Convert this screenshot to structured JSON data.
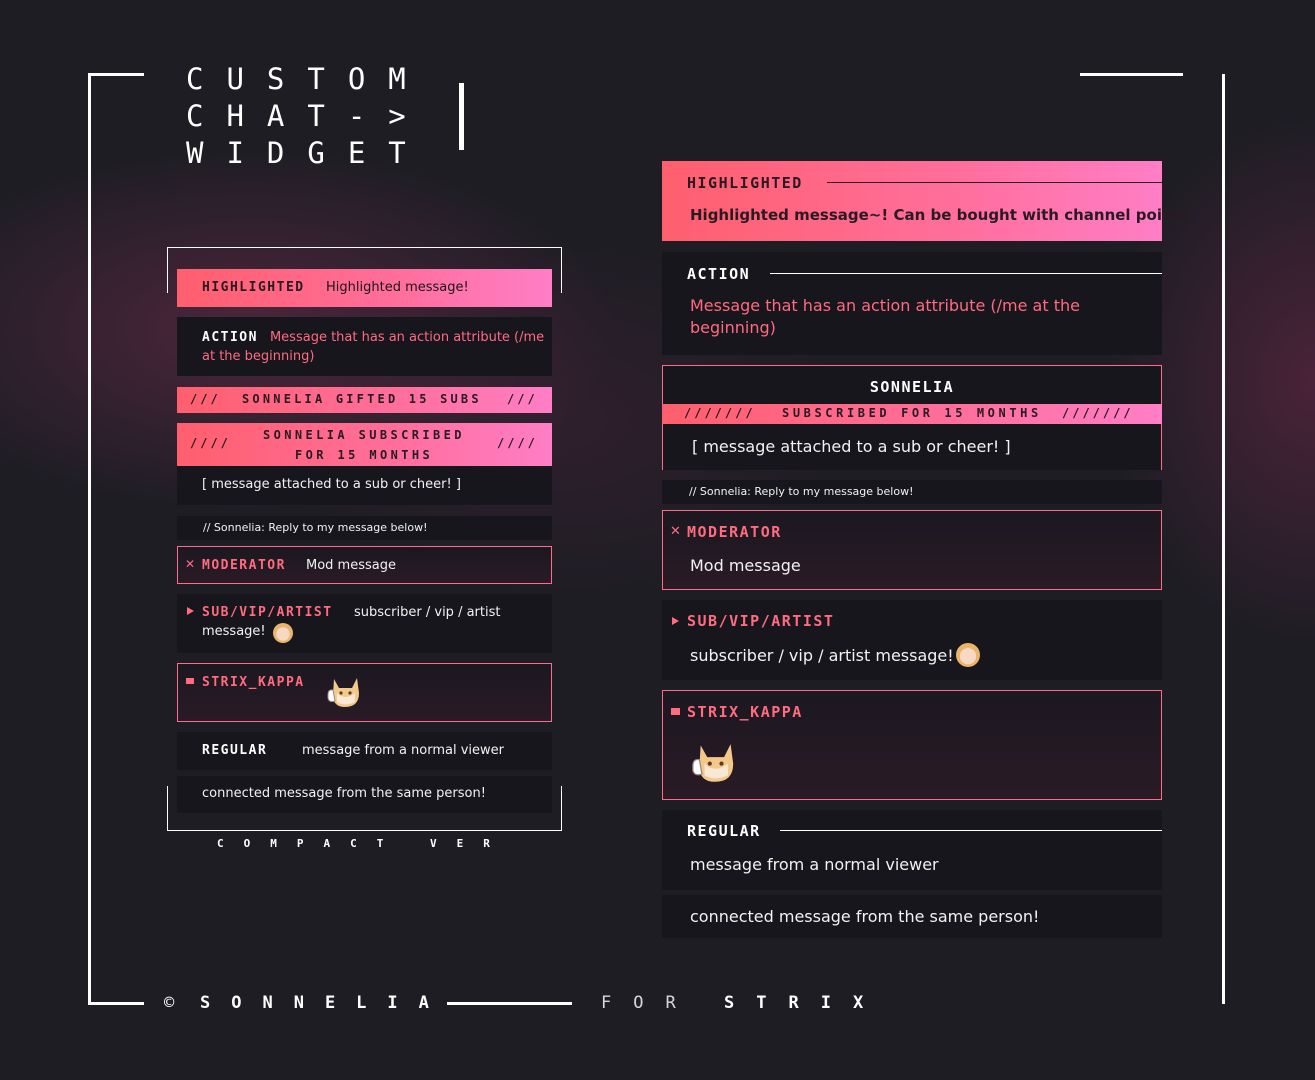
{
  "title": {
    "line1": "CUSTOM",
    "line2": "CHAT->",
    "line3": "WIDGET"
  },
  "footer": {
    "copyright_symbol": "©",
    "author": "SONNELIA",
    "for_label": "FOR",
    "client": "STRIX"
  },
  "compact": {
    "caption": "COMPACT VER",
    "highlighted": {
      "label": "HIGHLIGHTED",
      "message": "Highlighted message!"
    },
    "action": {
      "label": "ACTION",
      "message": "Message that has an action attribute (/me at the beginning)"
    },
    "gift": {
      "slashes": "///",
      "text": "SONNELIA GIFTED 15 SUBS"
    },
    "sub": {
      "slashes": "////",
      "line1": "SONNELIA SUBSCRIBED",
      "line2": "FOR 15 MONTHS",
      "message": "[ message attached to a sub or cheer! ]"
    },
    "reply": "// Sonnelia: Reply to my message below!",
    "moderator": {
      "label": "MODERATOR",
      "message": "Mod message",
      "icon": "sword-icon"
    },
    "subvip": {
      "label": "SUB/VIP/ARTIST",
      "message_line1": "subscriber / vip / artist",
      "message_line2": "message!",
      "icon": "play-icon"
    },
    "broadcaster": {
      "label": "STRIX_KAPPA",
      "icon": "camera-icon"
    },
    "regular": {
      "label": "REGULAR",
      "message": "message from a normal viewer"
    },
    "connected": {
      "message": "connected message from the same person!"
    }
  },
  "full": {
    "highlighted": {
      "label": "HIGHLIGHTED",
      "message": "Highlighted message~! Can be bought with channel points"
    },
    "action": {
      "label": "ACTION",
      "message_line1": "Message that has an action attribute (/me at the",
      "message_line2": "beginning)"
    },
    "sub": {
      "name": "SONNELIA",
      "slashes": "///////",
      "banner": "SUBSCRIBED FOR 15 MONTHS",
      "message": "[ message attached to a sub or cheer! ]"
    },
    "reply": "// Sonnelia: Reply to my message below!",
    "moderator": {
      "label": "MODERATOR",
      "message": "Mod message",
      "icon": "sword-icon"
    },
    "subvip": {
      "label": "SUB/VIP/ARTIST",
      "message": "subscriber / vip / artist message!",
      "icon": "play-icon"
    },
    "broadcaster": {
      "label": "STRIX_KAPPA",
      "icon": "camera-icon"
    },
    "regular": {
      "label": "REGULAR",
      "message": "message from a normal viewer"
    },
    "connected": {
      "message": "connected message from the same person!"
    }
  },
  "colors": {
    "background": "#1e1d24",
    "card": "#17161d",
    "accent_pink": "#ff6b7f",
    "gradient_start": "#ff5f6d",
    "gradient_end": "#ff7ec6"
  }
}
